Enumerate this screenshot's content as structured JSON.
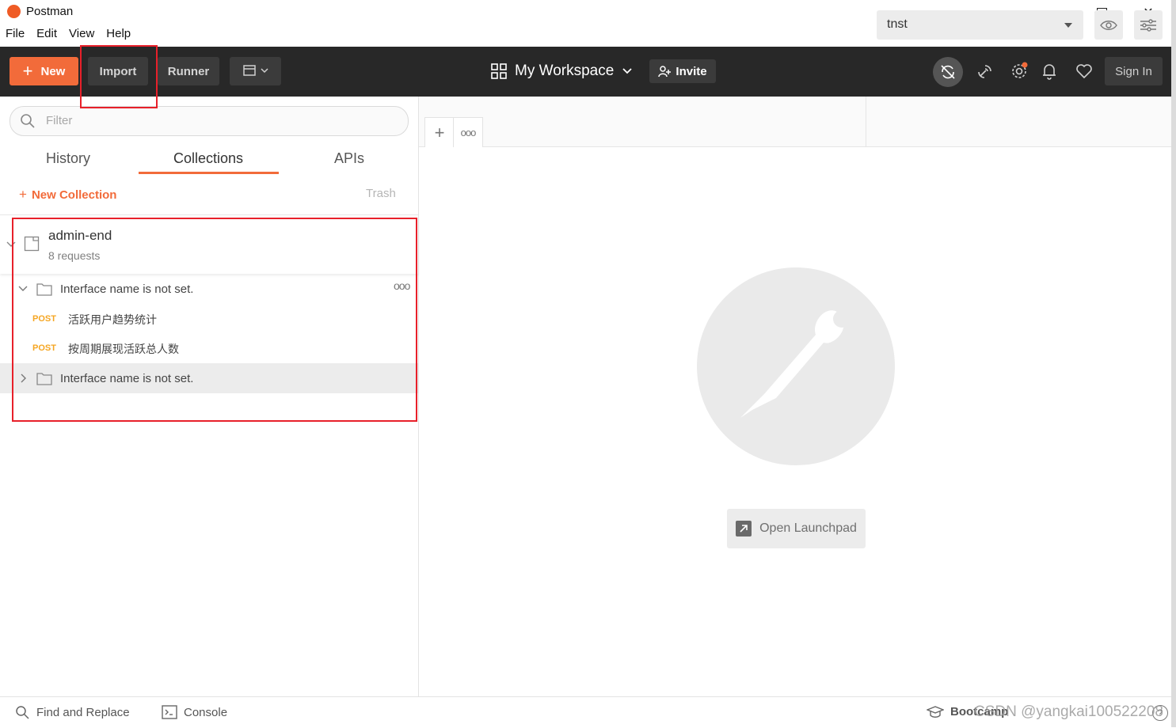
{
  "window": {
    "title": "Postman",
    "controls": {
      "minimize": "—",
      "maximize": "☐",
      "close": "✕"
    }
  },
  "menu": [
    "File",
    "Edit",
    "View",
    "Help"
  ],
  "header": {
    "new_label": "New",
    "import_label": "Import",
    "runner_label": "Runner",
    "workspace_label": "My Workspace",
    "invite_label": "Invite",
    "signin_label": "Sign In"
  },
  "sidebar": {
    "filter_placeholder": "Filter",
    "tabs": [
      "History",
      "Collections",
      "APIs"
    ],
    "active_tab": "Collections",
    "new_collection_label": "New Collection",
    "trash_label": "Trash",
    "collection": {
      "name": "admin-end",
      "count": "8 requests",
      "folders": [
        {
          "name": "Interface name is not set.",
          "expanded": true,
          "requests": [
            {
              "method": "POST",
              "name": "活跃用户趋势统计"
            },
            {
              "method": "POST",
              "name": "按周期展现活跃总人数"
            }
          ]
        },
        {
          "name": "Interface name is not set.",
          "expanded": false
        }
      ]
    }
  },
  "main": {
    "environment": "tnst",
    "launchpad_label": "Open Launchpad"
  },
  "footer": {
    "find_replace_label": "Find and Replace",
    "console_label": "Console",
    "bootcamp_label": "Bootcamp",
    "watermark": "CSDN @yangkai100522208"
  },
  "colors": {
    "accent": "#f26b3a",
    "header_bg": "#282828",
    "post_method": "#f5a623",
    "annotation_red": "#e8202a"
  }
}
